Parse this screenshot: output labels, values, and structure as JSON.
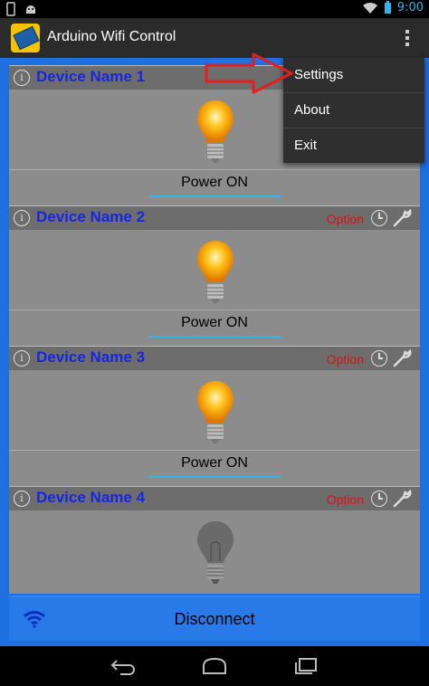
{
  "status_bar": {
    "time": "9:00"
  },
  "app": {
    "title": "Arduino Wifi Control"
  },
  "menu": {
    "items": [
      "Settings",
      "About",
      "Exit"
    ]
  },
  "devices": [
    {
      "name": "Device Name 1",
      "option": "",
      "power": "Power ON",
      "bulb_on": true
    },
    {
      "name": "Device Name 2",
      "option": "Option",
      "power": "Power ON",
      "bulb_on": true
    },
    {
      "name": "Device Name 3",
      "option": "Option",
      "power": "Power ON",
      "bulb_on": true
    },
    {
      "name": "Device Name 4",
      "option": "Option",
      "power": "",
      "bulb_on": false
    }
  ],
  "footer": {
    "disconnect_label": "Disconnect"
  },
  "colors": {
    "accent": "#33b5e5",
    "background": "#1e6fe0",
    "device_name": "#1726e0",
    "option": "#d61414"
  },
  "icons": [
    "info-icon",
    "clock-icon",
    "wrench-icon",
    "bulb-icon",
    "wifi-icon",
    "back-icon",
    "home-icon",
    "recents-icon",
    "overflow-menu-icon"
  ]
}
